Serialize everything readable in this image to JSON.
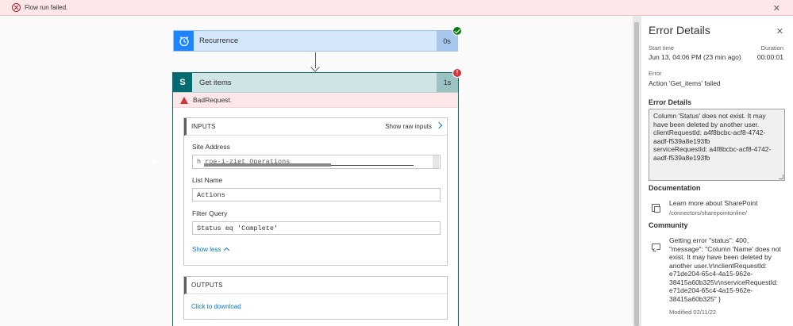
{
  "banner": {
    "message": "Flow run failed.",
    "close_glyph": "✕"
  },
  "flow": {
    "recurrence": {
      "label": "Recurrence",
      "duration": "0s",
      "status": "succeeded",
      "color": "#1f85ff"
    },
    "get_items": {
      "label": "Get items",
      "icon_letter": "S",
      "duration": "1s",
      "status": "failed",
      "color": "#036c70",
      "error_code": "BadRequest.",
      "badge_glyph": "!",
      "inputs": {
        "title": "INPUTS",
        "show_raw": "Show raw inputs",
        "site_address_label": "Site Address",
        "site_address_value": "h   roe-i-ziet       Operations",
        "list_name_label": "List Name",
        "list_name_value": "Actions",
        "filter_query_label": "Filter Query",
        "filter_query_value": "Status eq 'Complete'",
        "show_less": "Show less"
      },
      "outputs": {
        "title": "OUTPUTS",
        "download": "Click to download"
      }
    }
  },
  "panel": {
    "title": "Error Details",
    "close_glyph": "✕",
    "start_time_label": "Start time",
    "start_time_value": "Jun 13, 04:06 PM (23 min ago)",
    "duration_label": "Duration",
    "duration_value": "00:00:01",
    "error_label": "Error",
    "error_value": "Action 'Get_items' failed",
    "error_details_heading": "Error Details",
    "error_details_text": "Column 'Status' does not exist. It may have been deleted by another user.\nclientRequestId: a4f8bcbc-acf8-4742-aadf-f539a8e193fb\nserviceRequestId: a4f8bcbc-acf8-4742-aadf-f539a8e193fb",
    "documentation_heading": "Documentation",
    "doc_link": "Learn more about SharePoint",
    "doc_path": "/connectors/sharepointonline/",
    "community_heading": "Community",
    "community_text": "Getting error \"status\": 400, \"message\": \"Column 'Name' does not exist. It may have been deleted by another user.\\r\\nclientRequestId: e71de204-65c4-4a15-962e-38415a60b325\\r\\nserviceRequestId: e71de204-65c4-4a15-962e-38415a60b325\" }",
    "community_modified": "Modified 02/11/22"
  }
}
